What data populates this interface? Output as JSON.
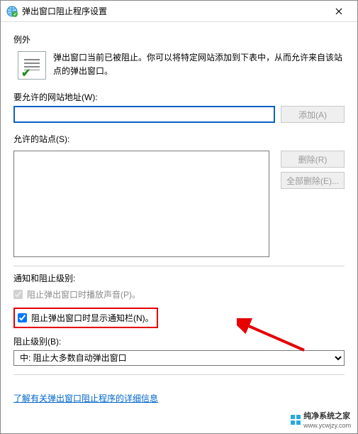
{
  "window": {
    "title": "弹出窗口阻止程序设置"
  },
  "exceptions": {
    "heading": "例外",
    "description": "弹出窗口当前已被阻止。你可以将特定网站添加到下表中，从而允许来自该站点的弹出窗口。",
    "address_label": "要允许的网站地址(W):",
    "address_value": "",
    "add_button": "添加(A)",
    "allowed_label": "允许的站点(S):",
    "remove_button": "删除(R)",
    "remove_all_button": "全部删除(E)..."
  },
  "notify": {
    "heading": "通知和阻止级别:",
    "play_sound_label": "阻止弹出窗口时播放声音(P)。",
    "play_sound_checked": true,
    "show_bar_label": "阻止弹出窗口时显示通知栏(N)。",
    "show_bar_checked": true,
    "level_label": "阻止级别(B):",
    "level_value": "中: 阻止大多数自动弹出窗口"
  },
  "footer": {
    "learn_more": "了解有关弹出窗口阻止程序的详细信息"
  },
  "watermark": {
    "brand": "纯净系统之家",
    "url": "www.ycwjzy.com"
  }
}
